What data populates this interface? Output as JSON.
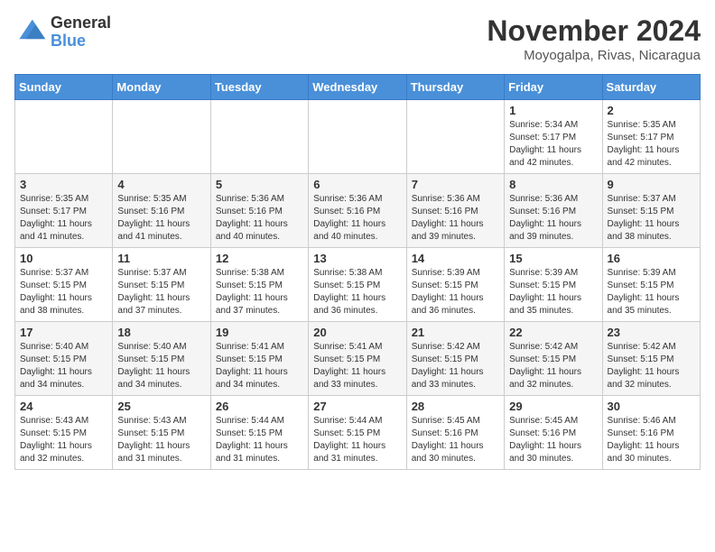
{
  "header": {
    "logo_general": "General",
    "logo_blue": "Blue",
    "month_title": "November 2024",
    "location": "Moyogalpa, Rivas, Nicaragua"
  },
  "weekdays": [
    "Sunday",
    "Monday",
    "Tuesday",
    "Wednesday",
    "Thursday",
    "Friday",
    "Saturday"
  ],
  "weeks": [
    [
      {
        "day": "",
        "info": ""
      },
      {
        "day": "",
        "info": ""
      },
      {
        "day": "",
        "info": ""
      },
      {
        "day": "",
        "info": ""
      },
      {
        "day": "",
        "info": ""
      },
      {
        "day": "1",
        "info": "Sunrise: 5:34 AM\nSunset: 5:17 PM\nDaylight: 11 hours\nand 42 minutes."
      },
      {
        "day": "2",
        "info": "Sunrise: 5:35 AM\nSunset: 5:17 PM\nDaylight: 11 hours\nand 42 minutes."
      }
    ],
    [
      {
        "day": "3",
        "info": "Sunrise: 5:35 AM\nSunset: 5:17 PM\nDaylight: 11 hours\nand 41 minutes."
      },
      {
        "day": "4",
        "info": "Sunrise: 5:35 AM\nSunset: 5:16 PM\nDaylight: 11 hours\nand 41 minutes."
      },
      {
        "day": "5",
        "info": "Sunrise: 5:36 AM\nSunset: 5:16 PM\nDaylight: 11 hours\nand 40 minutes."
      },
      {
        "day": "6",
        "info": "Sunrise: 5:36 AM\nSunset: 5:16 PM\nDaylight: 11 hours\nand 40 minutes."
      },
      {
        "day": "7",
        "info": "Sunrise: 5:36 AM\nSunset: 5:16 PM\nDaylight: 11 hours\nand 39 minutes."
      },
      {
        "day": "8",
        "info": "Sunrise: 5:36 AM\nSunset: 5:16 PM\nDaylight: 11 hours\nand 39 minutes."
      },
      {
        "day": "9",
        "info": "Sunrise: 5:37 AM\nSunset: 5:15 PM\nDaylight: 11 hours\nand 38 minutes."
      }
    ],
    [
      {
        "day": "10",
        "info": "Sunrise: 5:37 AM\nSunset: 5:15 PM\nDaylight: 11 hours\nand 38 minutes."
      },
      {
        "day": "11",
        "info": "Sunrise: 5:37 AM\nSunset: 5:15 PM\nDaylight: 11 hours\nand 37 minutes."
      },
      {
        "day": "12",
        "info": "Sunrise: 5:38 AM\nSunset: 5:15 PM\nDaylight: 11 hours\nand 37 minutes."
      },
      {
        "day": "13",
        "info": "Sunrise: 5:38 AM\nSunset: 5:15 PM\nDaylight: 11 hours\nand 36 minutes."
      },
      {
        "day": "14",
        "info": "Sunrise: 5:39 AM\nSunset: 5:15 PM\nDaylight: 11 hours\nand 36 minutes."
      },
      {
        "day": "15",
        "info": "Sunrise: 5:39 AM\nSunset: 5:15 PM\nDaylight: 11 hours\nand 35 minutes."
      },
      {
        "day": "16",
        "info": "Sunrise: 5:39 AM\nSunset: 5:15 PM\nDaylight: 11 hours\nand 35 minutes."
      }
    ],
    [
      {
        "day": "17",
        "info": "Sunrise: 5:40 AM\nSunset: 5:15 PM\nDaylight: 11 hours\nand 34 minutes."
      },
      {
        "day": "18",
        "info": "Sunrise: 5:40 AM\nSunset: 5:15 PM\nDaylight: 11 hours\nand 34 minutes."
      },
      {
        "day": "19",
        "info": "Sunrise: 5:41 AM\nSunset: 5:15 PM\nDaylight: 11 hours\nand 34 minutes."
      },
      {
        "day": "20",
        "info": "Sunrise: 5:41 AM\nSunset: 5:15 PM\nDaylight: 11 hours\nand 33 minutes."
      },
      {
        "day": "21",
        "info": "Sunrise: 5:42 AM\nSunset: 5:15 PM\nDaylight: 11 hours\nand 33 minutes."
      },
      {
        "day": "22",
        "info": "Sunrise: 5:42 AM\nSunset: 5:15 PM\nDaylight: 11 hours\nand 32 minutes."
      },
      {
        "day": "23",
        "info": "Sunrise: 5:42 AM\nSunset: 5:15 PM\nDaylight: 11 hours\nand 32 minutes."
      }
    ],
    [
      {
        "day": "24",
        "info": "Sunrise: 5:43 AM\nSunset: 5:15 PM\nDaylight: 11 hours\nand 32 minutes."
      },
      {
        "day": "25",
        "info": "Sunrise: 5:43 AM\nSunset: 5:15 PM\nDaylight: 11 hours\nand 31 minutes."
      },
      {
        "day": "26",
        "info": "Sunrise: 5:44 AM\nSunset: 5:15 PM\nDaylight: 11 hours\nand 31 minutes."
      },
      {
        "day": "27",
        "info": "Sunrise: 5:44 AM\nSunset: 5:15 PM\nDaylight: 11 hours\nand 31 minutes."
      },
      {
        "day": "28",
        "info": "Sunrise: 5:45 AM\nSunset: 5:16 PM\nDaylight: 11 hours\nand 30 minutes."
      },
      {
        "day": "29",
        "info": "Sunrise: 5:45 AM\nSunset: 5:16 PM\nDaylight: 11 hours\nand 30 minutes."
      },
      {
        "day": "30",
        "info": "Sunrise: 5:46 AM\nSunset: 5:16 PM\nDaylight: 11 hours\nand 30 minutes."
      }
    ]
  ]
}
